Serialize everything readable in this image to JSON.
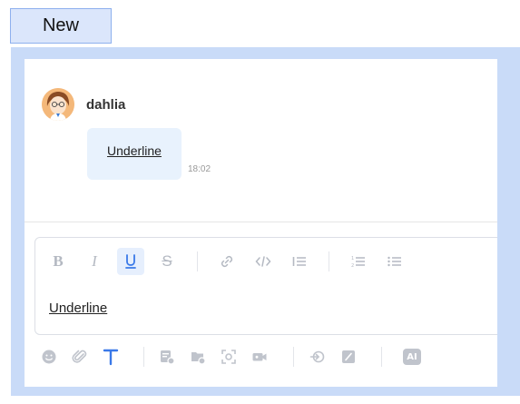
{
  "tab": {
    "label": "New"
  },
  "message": {
    "username": "dahlia",
    "text": "Underline",
    "time": "18:02"
  },
  "toolbar": {
    "bold": "B",
    "italic": "I",
    "strike": "S",
    "active_format": "underline"
  },
  "editor": {
    "content": "Underline"
  },
  "bottom_tools": {
    "ai_label": "AI"
  },
  "colors": {
    "accent": "#3a79e8",
    "bubble": "#e8f2fd",
    "frame": "#c9dbf8",
    "icon": "#c0c4cc"
  }
}
